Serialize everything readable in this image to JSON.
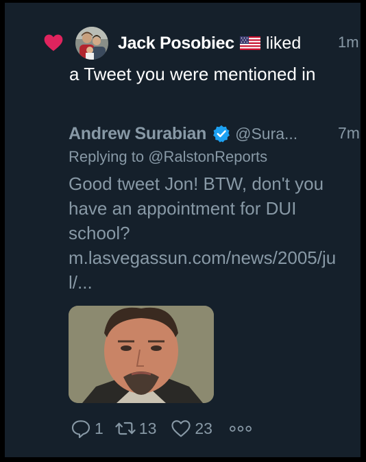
{
  "notification": {
    "user": "Jack Posobiec",
    "verb": "liked",
    "time": "1m",
    "text": "a Tweet you were mentioned in"
  },
  "tweet": {
    "author_name": "Andrew Surabian",
    "author_handle": "@Sura...",
    "time": "7m",
    "reply_prefix": "Replying to",
    "reply_to": "@RalstonReports",
    "body": "Good tweet Jon! BTW, don't you have an appointment for DUI school?",
    "link": "m.lasvegassun.com/news/2005/jul/...",
    "counts": {
      "replies": "1",
      "retweets": "13",
      "likes": "23"
    }
  },
  "colors": {
    "background": "#15202b",
    "heart": "#e0245e",
    "muted": "#8899a6",
    "verified": "#1da1f2"
  },
  "icons": [
    "heart-icon",
    "flag-icon",
    "verified-badge-icon",
    "reply-icon",
    "retweet-icon",
    "like-icon",
    "more-icon"
  ]
}
